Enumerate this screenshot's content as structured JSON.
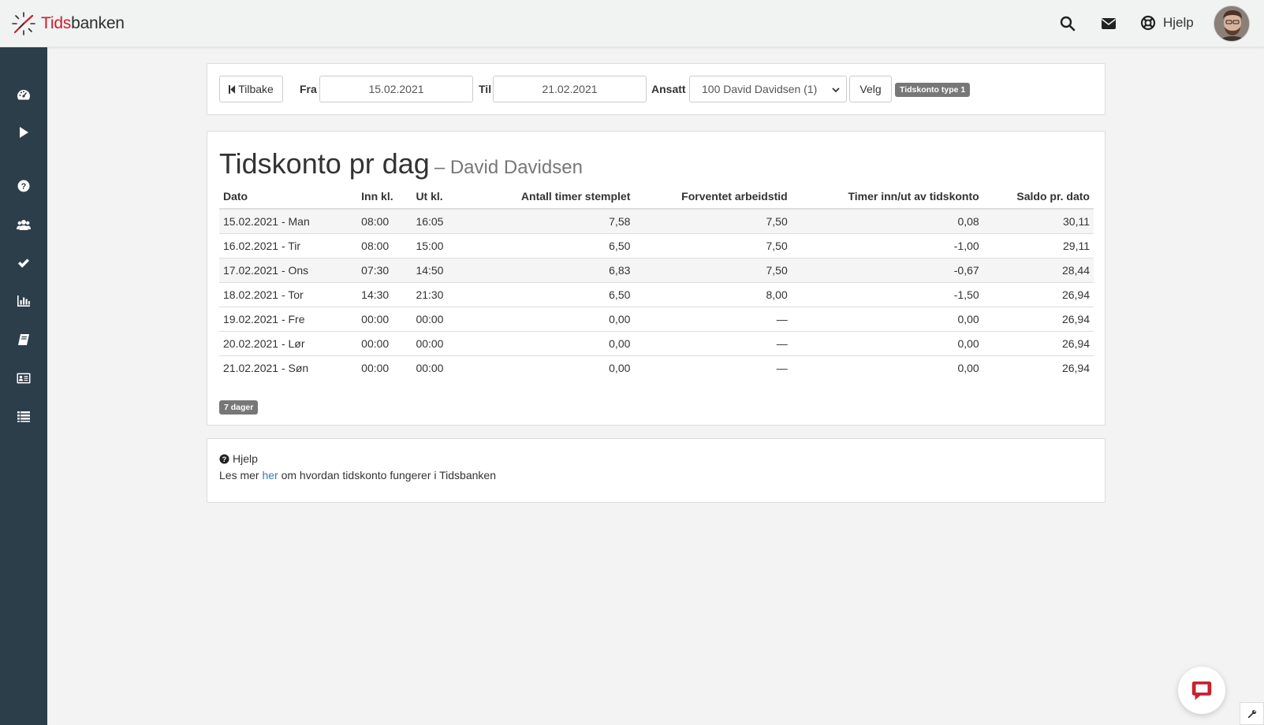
{
  "brand": {
    "name_accent": "Tids",
    "name_rest": "banken",
    "accent_color": "#c8202f"
  },
  "topbar": {
    "help_label": "Hjelp"
  },
  "sidebar": {
    "items": [
      "dashboard-icon",
      "play-icon",
      "question-icon",
      "users-icon",
      "check-icon",
      "bar-chart-icon",
      "book-icon",
      "id-card-icon",
      "list-icon"
    ]
  },
  "filter": {
    "back_label": "Tilbake",
    "from_label": "Fra",
    "from_value": "15.02.2021",
    "to_label": "Til",
    "to_value": "21.02.2021",
    "employee_label": "Ansatt",
    "employee_value": "100 David Davidsen (1)",
    "choose_label": "Velg",
    "type_badge": "Tidskonto type 1"
  },
  "main": {
    "title": "Tidskonto pr dag",
    "subtitle": "– David Davidsen",
    "columns": [
      "Dato",
      "Inn kl.",
      "Ut kl.",
      "Antall timer stemplet",
      "Forventet arbeidstid",
      "Timer inn/ut av tidskonto",
      "Saldo pr. dato"
    ],
    "rows": [
      [
        "15.02.2021 - Man",
        "08:00",
        "16:05",
        "7,58",
        "7,50",
        "0,08",
        "30,11"
      ],
      [
        "16.02.2021 - Tir",
        "08:00",
        "15:00",
        "6,50",
        "7,50",
        "-1,00",
        "29,11"
      ],
      [
        "17.02.2021 - Ons",
        "07:30",
        "14:50",
        "6,83",
        "7,50",
        "-0,67",
        "28,44"
      ],
      [
        "18.02.2021 - Tor",
        "14:30",
        "21:30",
        "6,50",
        "8,00",
        "-1,50",
        "26,94"
      ],
      [
        "19.02.2021 - Fre",
        "00:00",
        "00:00",
        "0,00",
        "—",
        "0,00",
        "26,94"
      ],
      [
        "20.02.2021 - Lør",
        "00:00",
        "00:00",
        "0,00",
        "—",
        "0,00",
        "26,94"
      ],
      [
        "21.02.2021 - Søn",
        "00:00",
        "00:00",
        "0,00",
        "—",
        "0,00",
        "26,94"
      ]
    ],
    "days_badge": "7 dager"
  },
  "help": {
    "title": "Hjelp",
    "text_before": "Les mer ",
    "link_text": "her",
    "text_after": " om hvordan tidskonto fungerer i Tidsbanken"
  },
  "colors": {
    "sidebar": "#2c3e4a",
    "link": "#337ab7",
    "badge": "#777777",
    "chat": "#c8202f"
  }
}
